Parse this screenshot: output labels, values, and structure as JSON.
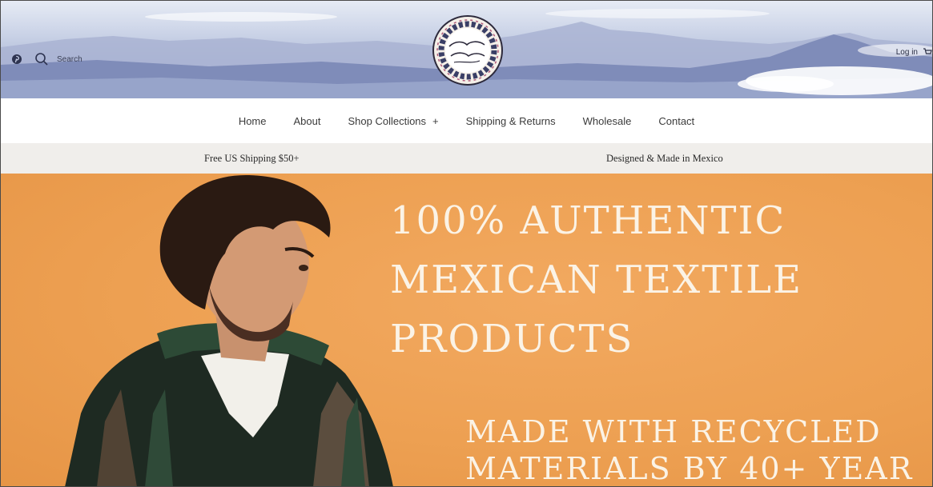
{
  "header": {
    "search_label": "Search",
    "login_label": "Log in",
    "icons": [
      "pinterest-icon",
      "search-icon"
    ]
  },
  "nav": {
    "items": [
      {
        "label": "Home"
      },
      {
        "label": "About"
      },
      {
        "label": "Shop Collections",
        "expander": "+"
      },
      {
        "label": "Shipping & Returns"
      },
      {
        "label": "Wholesale"
      },
      {
        "label": "Contact"
      }
    ]
  },
  "announcement": {
    "messages": [
      "Free US Shipping $50+",
      "Designed & Made in Mexico"
    ]
  },
  "hero": {
    "headline_lines": [
      "100% AUTHENTIC",
      "MEXICAN TEXTILE",
      "PRODUCTS"
    ],
    "subline_lines": [
      "MADE WITH RECYCLED",
      "MATERIALS BY 40+ YEAR"
    ]
  },
  "colors": {
    "hero_background": "#eda052",
    "hero_text": "#fbf3e6",
    "announcement_bar": "#f0eeeb",
    "banner_sky": "#bac4de"
  }
}
